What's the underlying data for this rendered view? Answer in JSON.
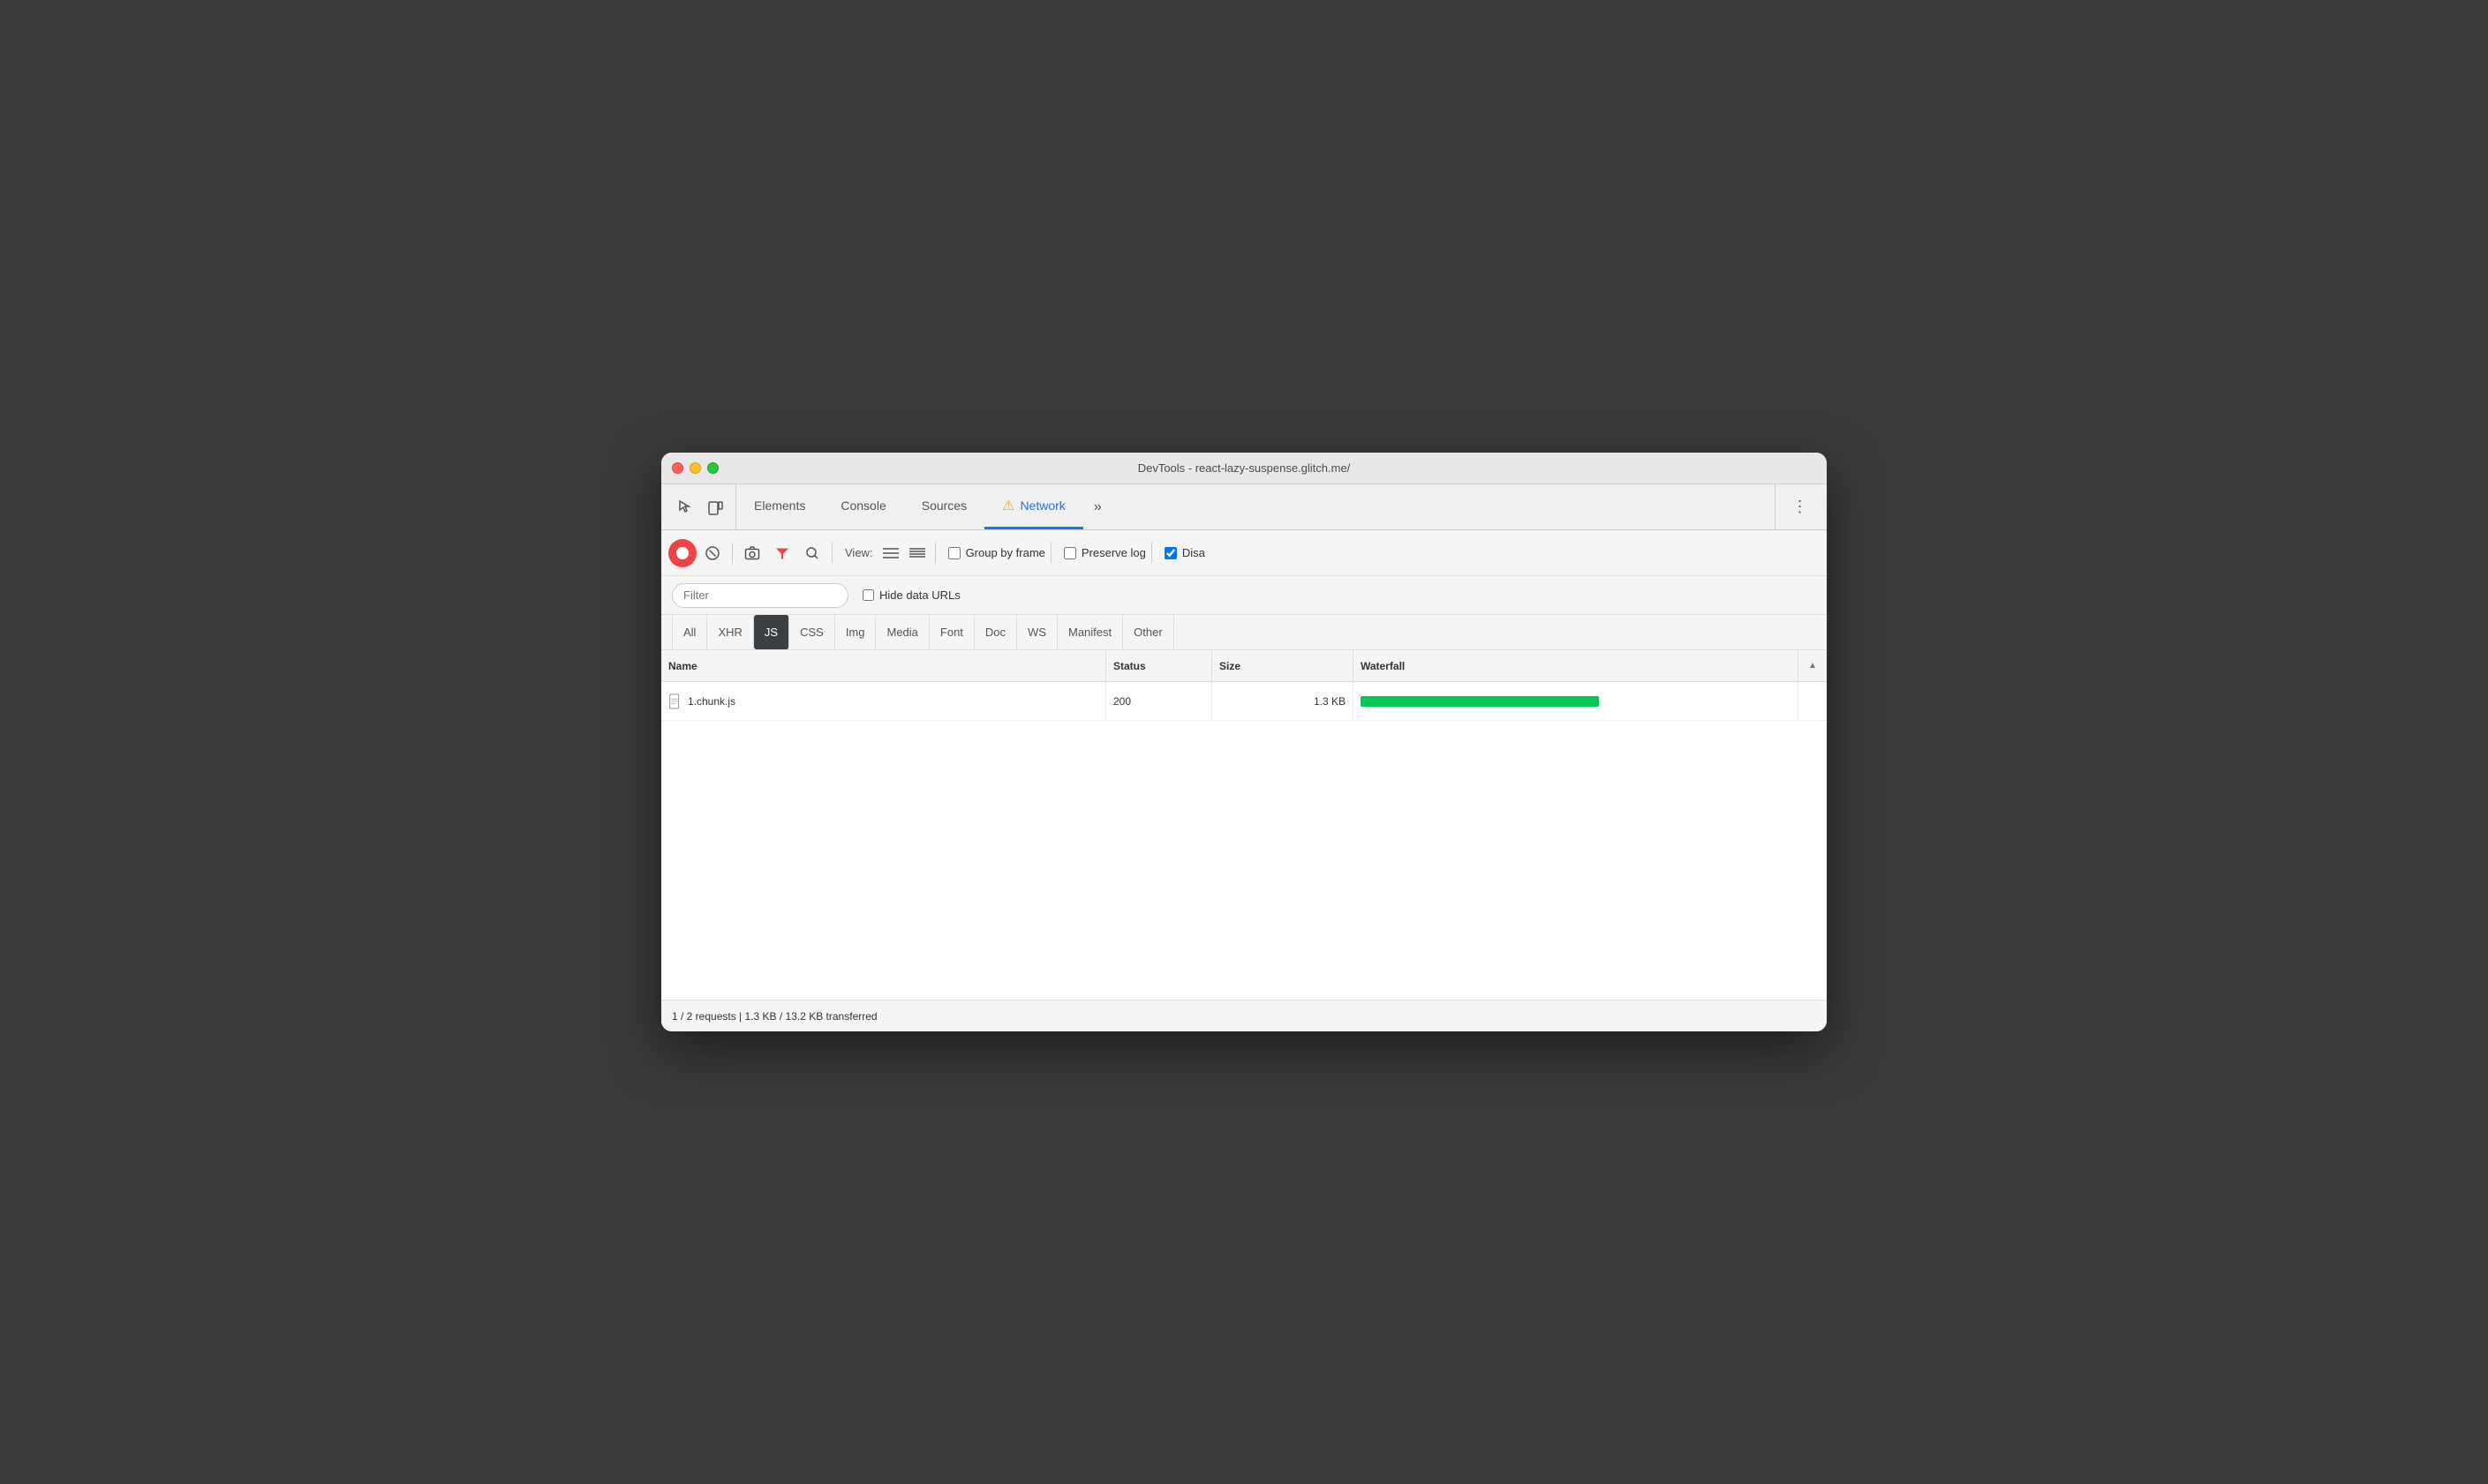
{
  "window": {
    "title": "DevTools - react-lazy-suspense.glitch.me/"
  },
  "tabs": {
    "items": [
      {
        "id": "elements",
        "label": "Elements",
        "active": false
      },
      {
        "id": "console",
        "label": "Console",
        "active": false
      },
      {
        "id": "sources",
        "label": "Sources",
        "active": false
      },
      {
        "id": "network",
        "label": "Network",
        "active": true
      },
      {
        "id": "more",
        "label": "»",
        "active": false
      }
    ]
  },
  "toolbar": {
    "record_title": "Record network log",
    "clear_title": "Clear",
    "camera_title": "Capture screenshot",
    "filter_title": "Filter",
    "search_title": "Search",
    "view_label": "View:",
    "group_by_frame_label": "Group by frame",
    "group_by_frame_checked": false,
    "preserve_log_label": "Preserve log",
    "preserve_log_checked": false,
    "disable_cache_label": "Disa",
    "disable_cache_checked": true
  },
  "filter_bar": {
    "placeholder": "Filter",
    "hide_data_urls_label": "Hide data URLs",
    "hide_data_urls_checked": false
  },
  "resource_types": {
    "items": [
      {
        "id": "all",
        "label": "All",
        "active": false
      },
      {
        "id": "xhr",
        "label": "XHR",
        "active": false
      },
      {
        "id": "js",
        "label": "JS",
        "active": true
      },
      {
        "id": "css",
        "label": "CSS",
        "active": false
      },
      {
        "id": "img",
        "label": "Img",
        "active": false
      },
      {
        "id": "media",
        "label": "Media",
        "active": false
      },
      {
        "id": "font",
        "label": "Font",
        "active": false
      },
      {
        "id": "doc",
        "label": "Doc",
        "active": false
      },
      {
        "id": "ws",
        "label": "WS",
        "active": false
      },
      {
        "id": "manifest",
        "label": "Manifest",
        "active": false
      },
      {
        "id": "other",
        "label": "Other",
        "active": false
      }
    ]
  },
  "table": {
    "columns": [
      {
        "id": "name",
        "label": "Name"
      },
      {
        "id": "status",
        "label": "Status"
      },
      {
        "id": "size",
        "label": "Size"
      },
      {
        "id": "waterfall",
        "label": "Waterfall"
      },
      {
        "id": "sort",
        "label": "▲"
      }
    ],
    "rows": [
      {
        "name": "1.chunk.js",
        "status": "200",
        "size": "1.3 KB",
        "waterfall_width": 270,
        "waterfall_color": "#00c853"
      }
    ]
  },
  "status_bar": {
    "text": "1 / 2 requests | 1.3 KB / 13.2 KB transferred"
  },
  "colors": {
    "active_tab": "#1a73e8",
    "record_red": "#e44",
    "waterfall_green": "#00c853",
    "js_badge_bg": "#5f6368",
    "js_badge_fg": "#ffffff"
  }
}
